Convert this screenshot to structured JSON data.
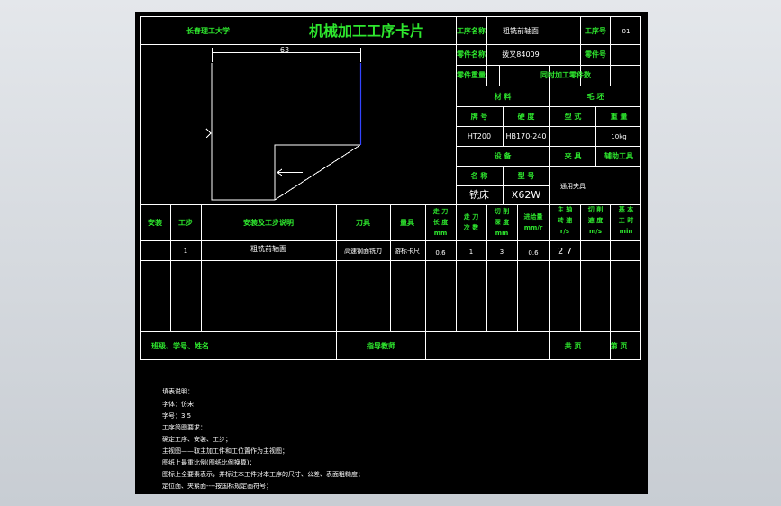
{
  "header": {
    "school": "长春理工大学",
    "title": "机械加工工序卡片",
    "process_name_label": "工序名称",
    "process_name_value": "粗铣前轴面",
    "process_no_label": "工序号",
    "process_no_value": "01",
    "part_name_label": "零件名称",
    "part_name_value": "拨叉84009",
    "part_no_label": "零件号",
    "part_weight_label": "零件重量",
    "same_parts_label": "同时加工零件数"
  },
  "material": {
    "heading": "材 料",
    "blank_heading": "毛 坯",
    "cols": [
      "牌 号",
      "硬 度",
      "型 式",
      "重 量"
    ],
    "grade": "HT200",
    "hardness": "HB170-240",
    "blank_type": "",
    "weight": "10kg"
  },
  "equipment": {
    "heading": "设 备",
    "fixture_heading": "夹 具",
    "aux_tool_heading": "辅助工具",
    "name_label": "名 称",
    "model_label": "型 号",
    "name": "铣床",
    "model": "X62W",
    "fixture": "通用夹具"
  },
  "drawing": {
    "dimension": "63"
  },
  "ops": {
    "headers": [
      "安装",
      "工步",
      "安装及工步说明",
      "刀具",
      "量具",
      "走刀长度mm",
      "走刀次数",
      "切削深度mm",
      "进给量mm/r",
      "主轴转速r/s",
      "切削速度m/s",
      "基本工时min"
    ],
    "row": {
      "step": "1",
      "desc": "粗铣前轴面",
      "tool": "高速钢面铣刀",
      "gauge": "游标卡尺",
      "length": "0.6",
      "passes": "1",
      "depth": "3",
      "feed": "0.6",
      "speed": "2 7"
    }
  },
  "footer": {
    "class_label": "班级、学号、姓名",
    "teacher_label": "指导教师",
    "total_pages_label": "共 页",
    "page_label": "第 页"
  },
  "notes": [
    "填表说明：",
    "字体：仿宋",
    "字号：3.5",
    "工序简图要求：",
    "确定工序、安装、工步；",
    "主视图——取主加工件和工位置作为主视图；",
    "图纸上最重比例(图纸比例换算)；",
    "图标上全要素表示，并标注本工件对本工序的尺寸、公差、表面粗糙度；",
    "定位面、夹紧面----按国标规定画符号；"
  ]
}
